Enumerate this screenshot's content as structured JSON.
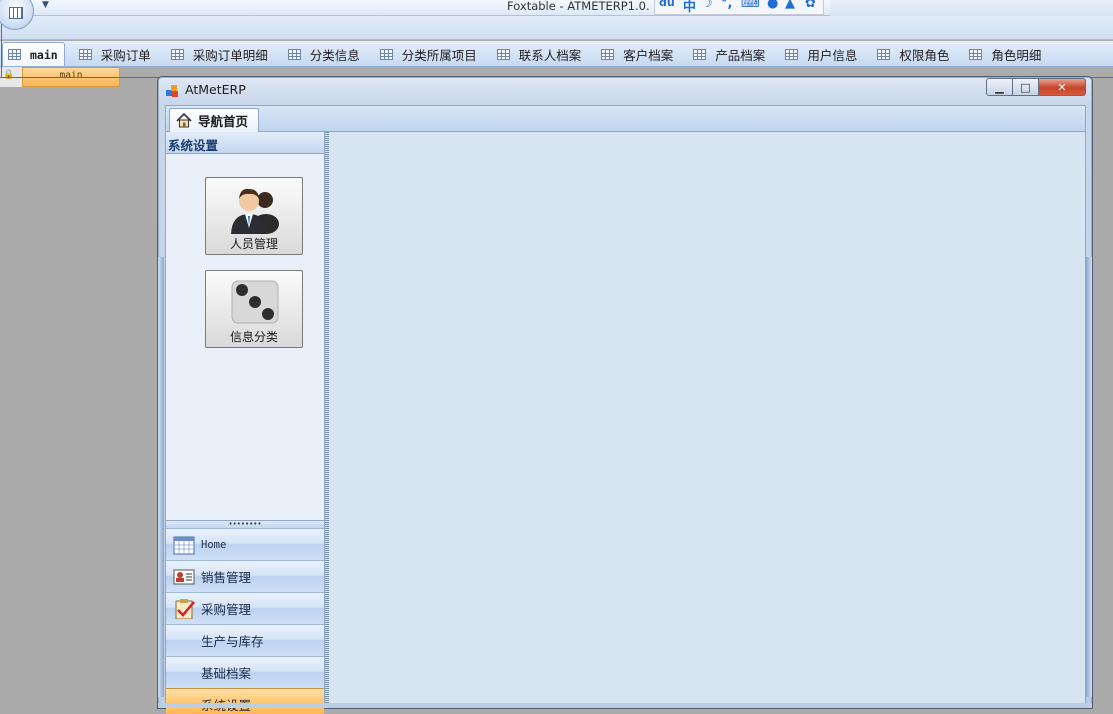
{
  "app": {
    "title": "Foxtable - ATMETERP1.0.",
    "ime_icons": [
      "du",
      "中",
      "☽",
      "°,",
      "⌨",
      "●",
      "▲",
      "✿"
    ]
  },
  "table_tabs": [
    {
      "label": "main",
      "active": true
    },
    {
      "label": "采购订单"
    },
    {
      "label": "采购订单明细"
    },
    {
      "label": "分类信息"
    },
    {
      "label": "分类所属项目"
    },
    {
      "label": "联系人档案"
    },
    {
      "label": "客户档案"
    },
    {
      "label": "产品档案"
    },
    {
      "label": "用户信息"
    },
    {
      "label": "权限角色"
    },
    {
      "label": "角色明细"
    }
  ],
  "sheet": {
    "label": "main"
  },
  "window": {
    "title": "AtMetERP",
    "caption_min": "▁",
    "caption_max": "□",
    "caption_close": "✕"
  },
  "doc_tab": {
    "label": "导航首页"
  },
  "group": {
    "header": "系统设置"
  },
  "big_buttons": [
    {
      "label": "人员管理"
    },
    {
      "label": "信息分类"
    }
  ],
  "nav": {
    "grip": "••••••••",
    "items": [
      {
        "label": "Home"
      },
      {
        "label": "销售管理"
      },
      {
        "label": "采购管理"
      },
      {
        "label": "生产与库存"
      },
      {
        "label": "基础档案"
      },
      {
        "label": "系统设置"
      }
    ]
  },
  "colors": {
    "accent_orange": "#ffb04a",
    "close_red": "#c7452b",
    "panel_blue": "#d2e1f3"
  }
}
